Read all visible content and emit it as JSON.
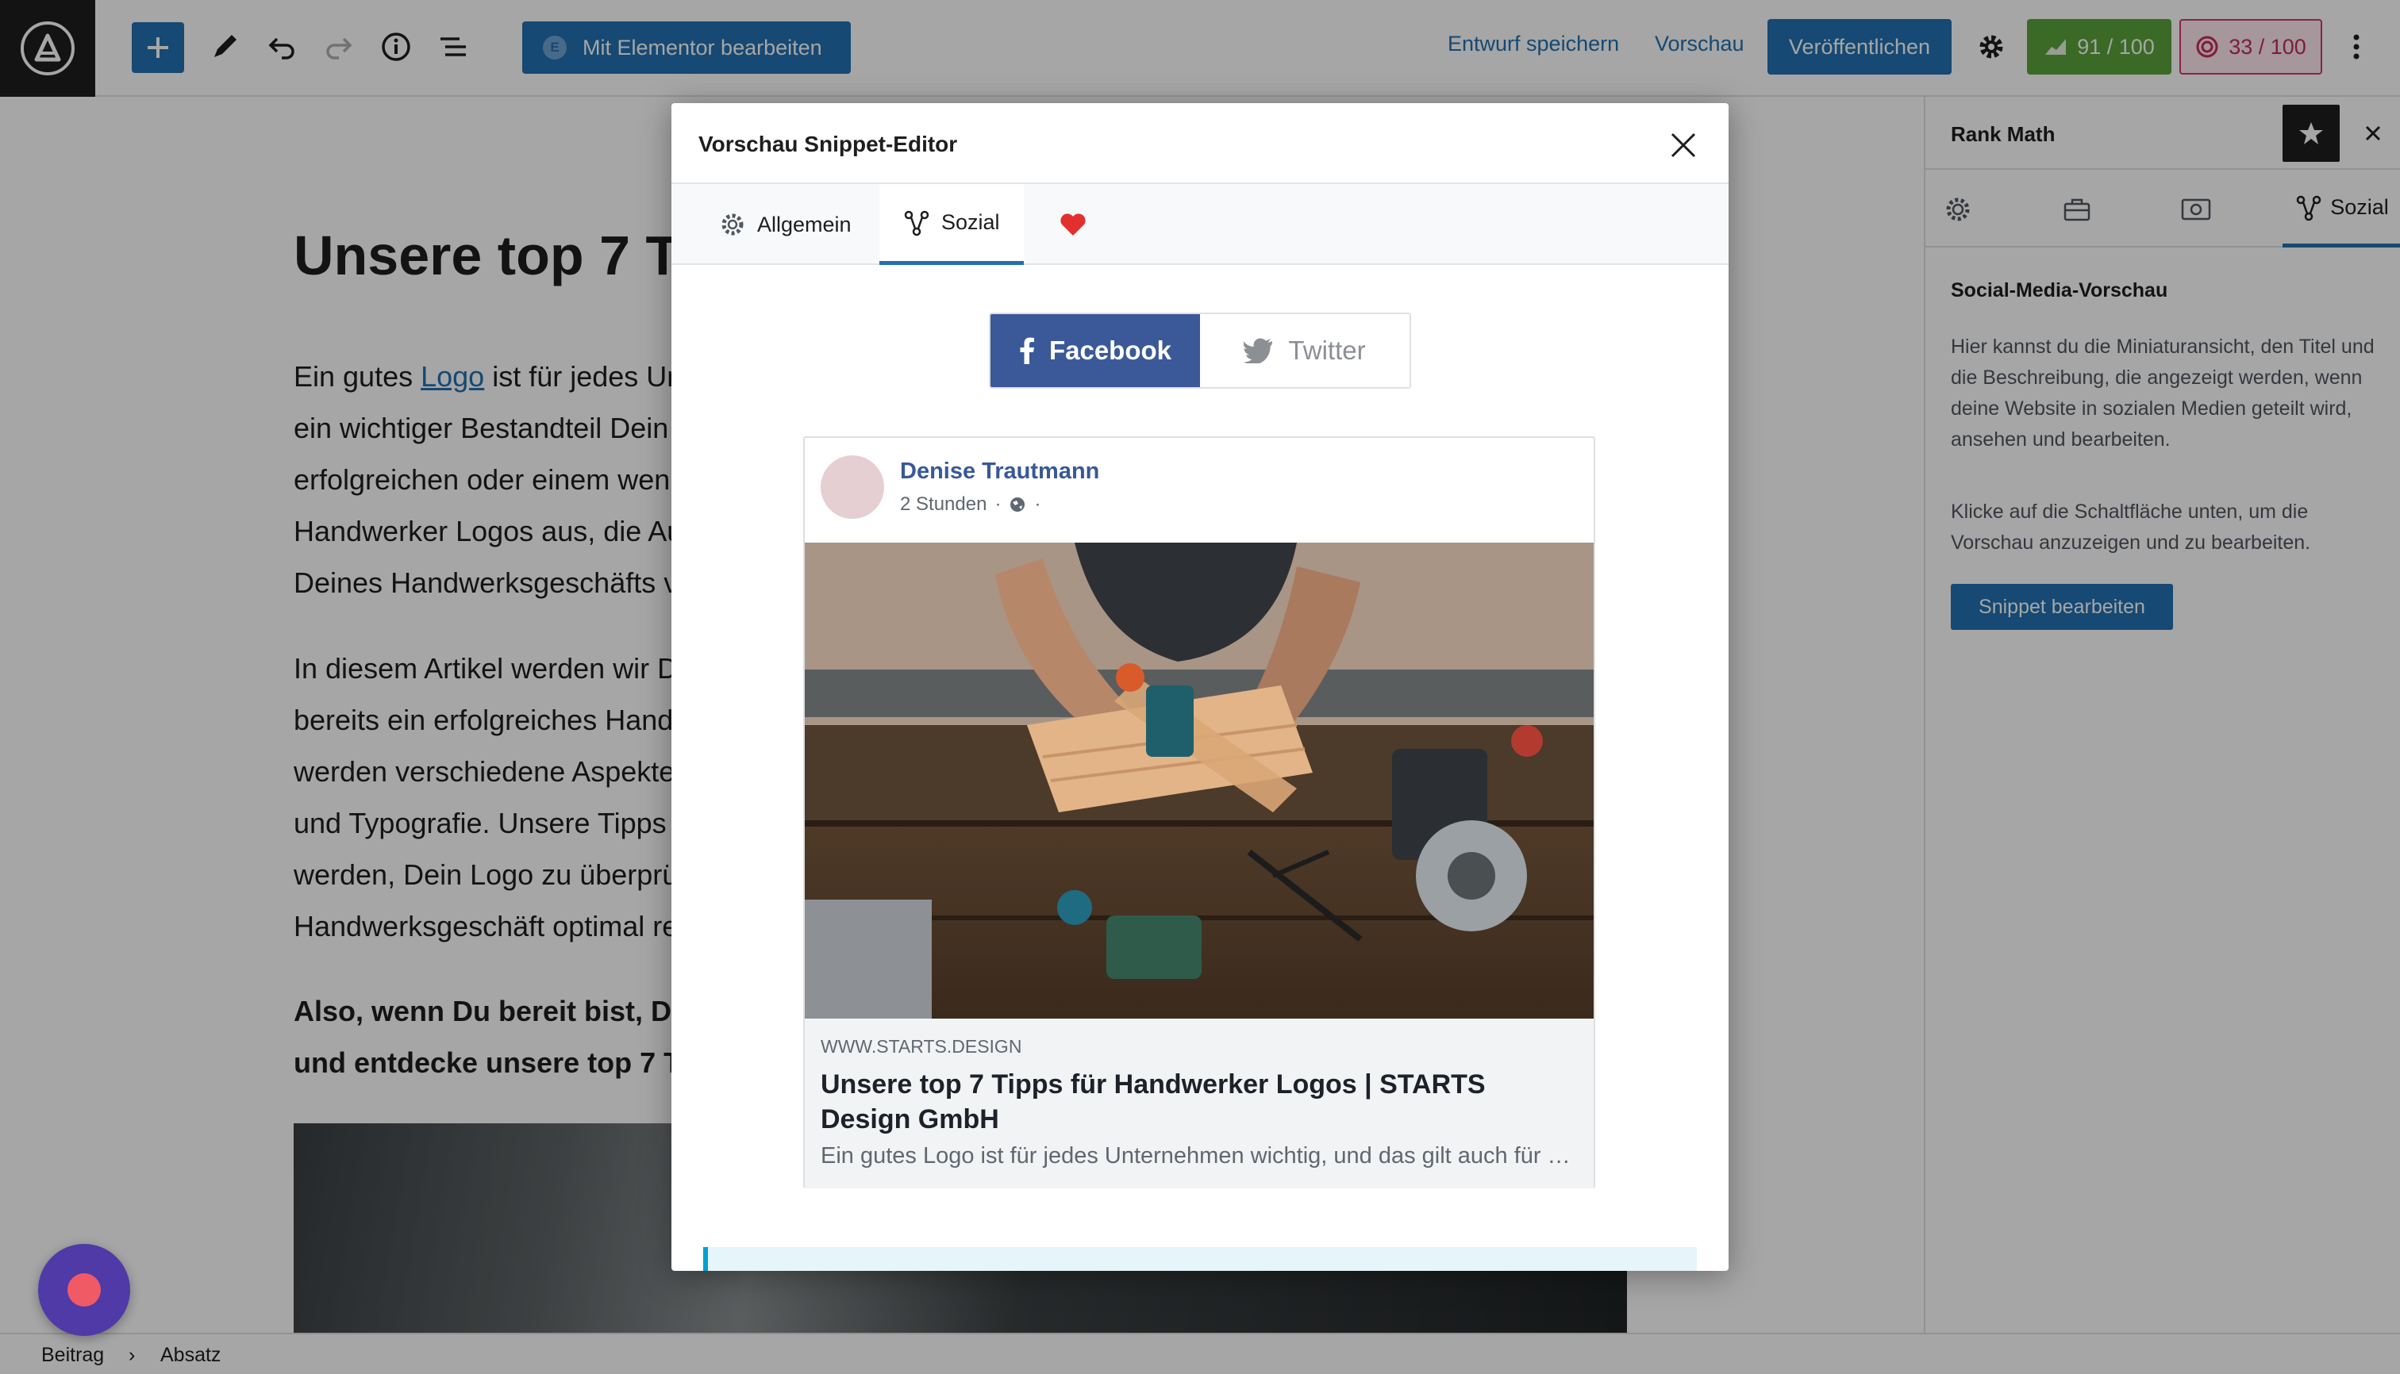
{
  "toolbar": {
    "elementor_label": "Mit Elementor bearbeiten",
    "save_draft": "Entwurf speichern",
    "preview": "Vorschau",
    "publish": "Veröffentlichen",
    "seo_score": "91 / 100",
    "content_score": "33 / 100"
  },
  "editor": {
    "title": "Unsere top 7 T",
    "paragraph1": {
      "before_link": "Ein gutes ",
      "link": "Logo",
      "after_link": " ist für jedes Un",
      "lines": [
        "ein wichtiger Bestandteil Dein",
        "erfolgreichen oder einem wen",
        "Handwerker Logos aus, die Au",
        "Deines Handwerksgeschäfts v"
      ]
    },
    "paragraph2": {
      "lines": [
        "In diesem Artikel werden wir D",
        "bereits ein erfolgreiches Hand",
        "werden verschiedene Aspekte",
        "und Typografie. Unsere Tipps",
        "werden, Dein Logo zu überprü",
        "Handwerksgeschäft optimal re"
      ]
    },
    "paragraph3": {
      "lines": [
        "Also, wenn Du bereit bist, De",
        "und entdecke unsere top 7 T"
      ]
    }
  },
  "sidebar": {
    "title": "Rank Math",
    "active_tab": "Sozial",
    "heading": "Social-Media-Vorschau",
    "text1": "Hier kannst du die Miniaturansicht, den Titel und die Beschreibung, die angezeigt werden, wenn deine Website in sozialen Medien geteilt wird, ansehen und bearbeiten.",
    "text2": "Klicke auf die Schaltfläche unten, um die Vorschau anzuzeigen und zu bearbeiten.",
    "button": "Snippet bearbeiten"
  },
  "modal": {
    "title": "Vorschau Snippet-Editor",
    "tabs": [
      "Allgemein",
      "Sozial"
    ],
    "active_tab": "Sozial",
    "networks": {
      "facebook": "Facebook",
      "twitter": "Twitter",
      "active": "Facebook"
    },
    "card": {
      "author": "Denise Trautmann",
      "time": "2 Stunden",
      "meta_separator": "·",
      "meta_trailing": "·",
      "domain": "WWW.STARTS.DESIGN",
      "title": "Unsere top 7 Tipps für Handwerker Logos | STARTS Design GmbH",
      "description": "Ein gutes Logo ist für jedes Unternehmen wichtig, und das gilt auch für Handwerker."
    }
  },
  "breadcrumb": {
    "items": [
      "Beitrag",
      "Absatz"
    ],
    "separator": "›"
  },
  "colors": {
    "accent": "#2271b1",
    "facebook": "#3b5998",
    "seo_good": "#5aa43b",
    "content_bad": "#d33866"
  },
  "icons": [
    "wordpress-logo-icon",
    "plus-icon",
    "pencil-icon",
    "undo-icon",
    "redo-icon",
    "info-icon",
    "list-view-icon",
    "settings-gear-icon",
    "more-vertical-icon",
    "star-icon",
    "close-icon",
    "toolbox-icon",
    "schema-icon",
    "share-nodes-icon",
    "heart-icon",
    "facebook-icon",
    "twitter-icon",
    "globe-icon"
  ]
}
